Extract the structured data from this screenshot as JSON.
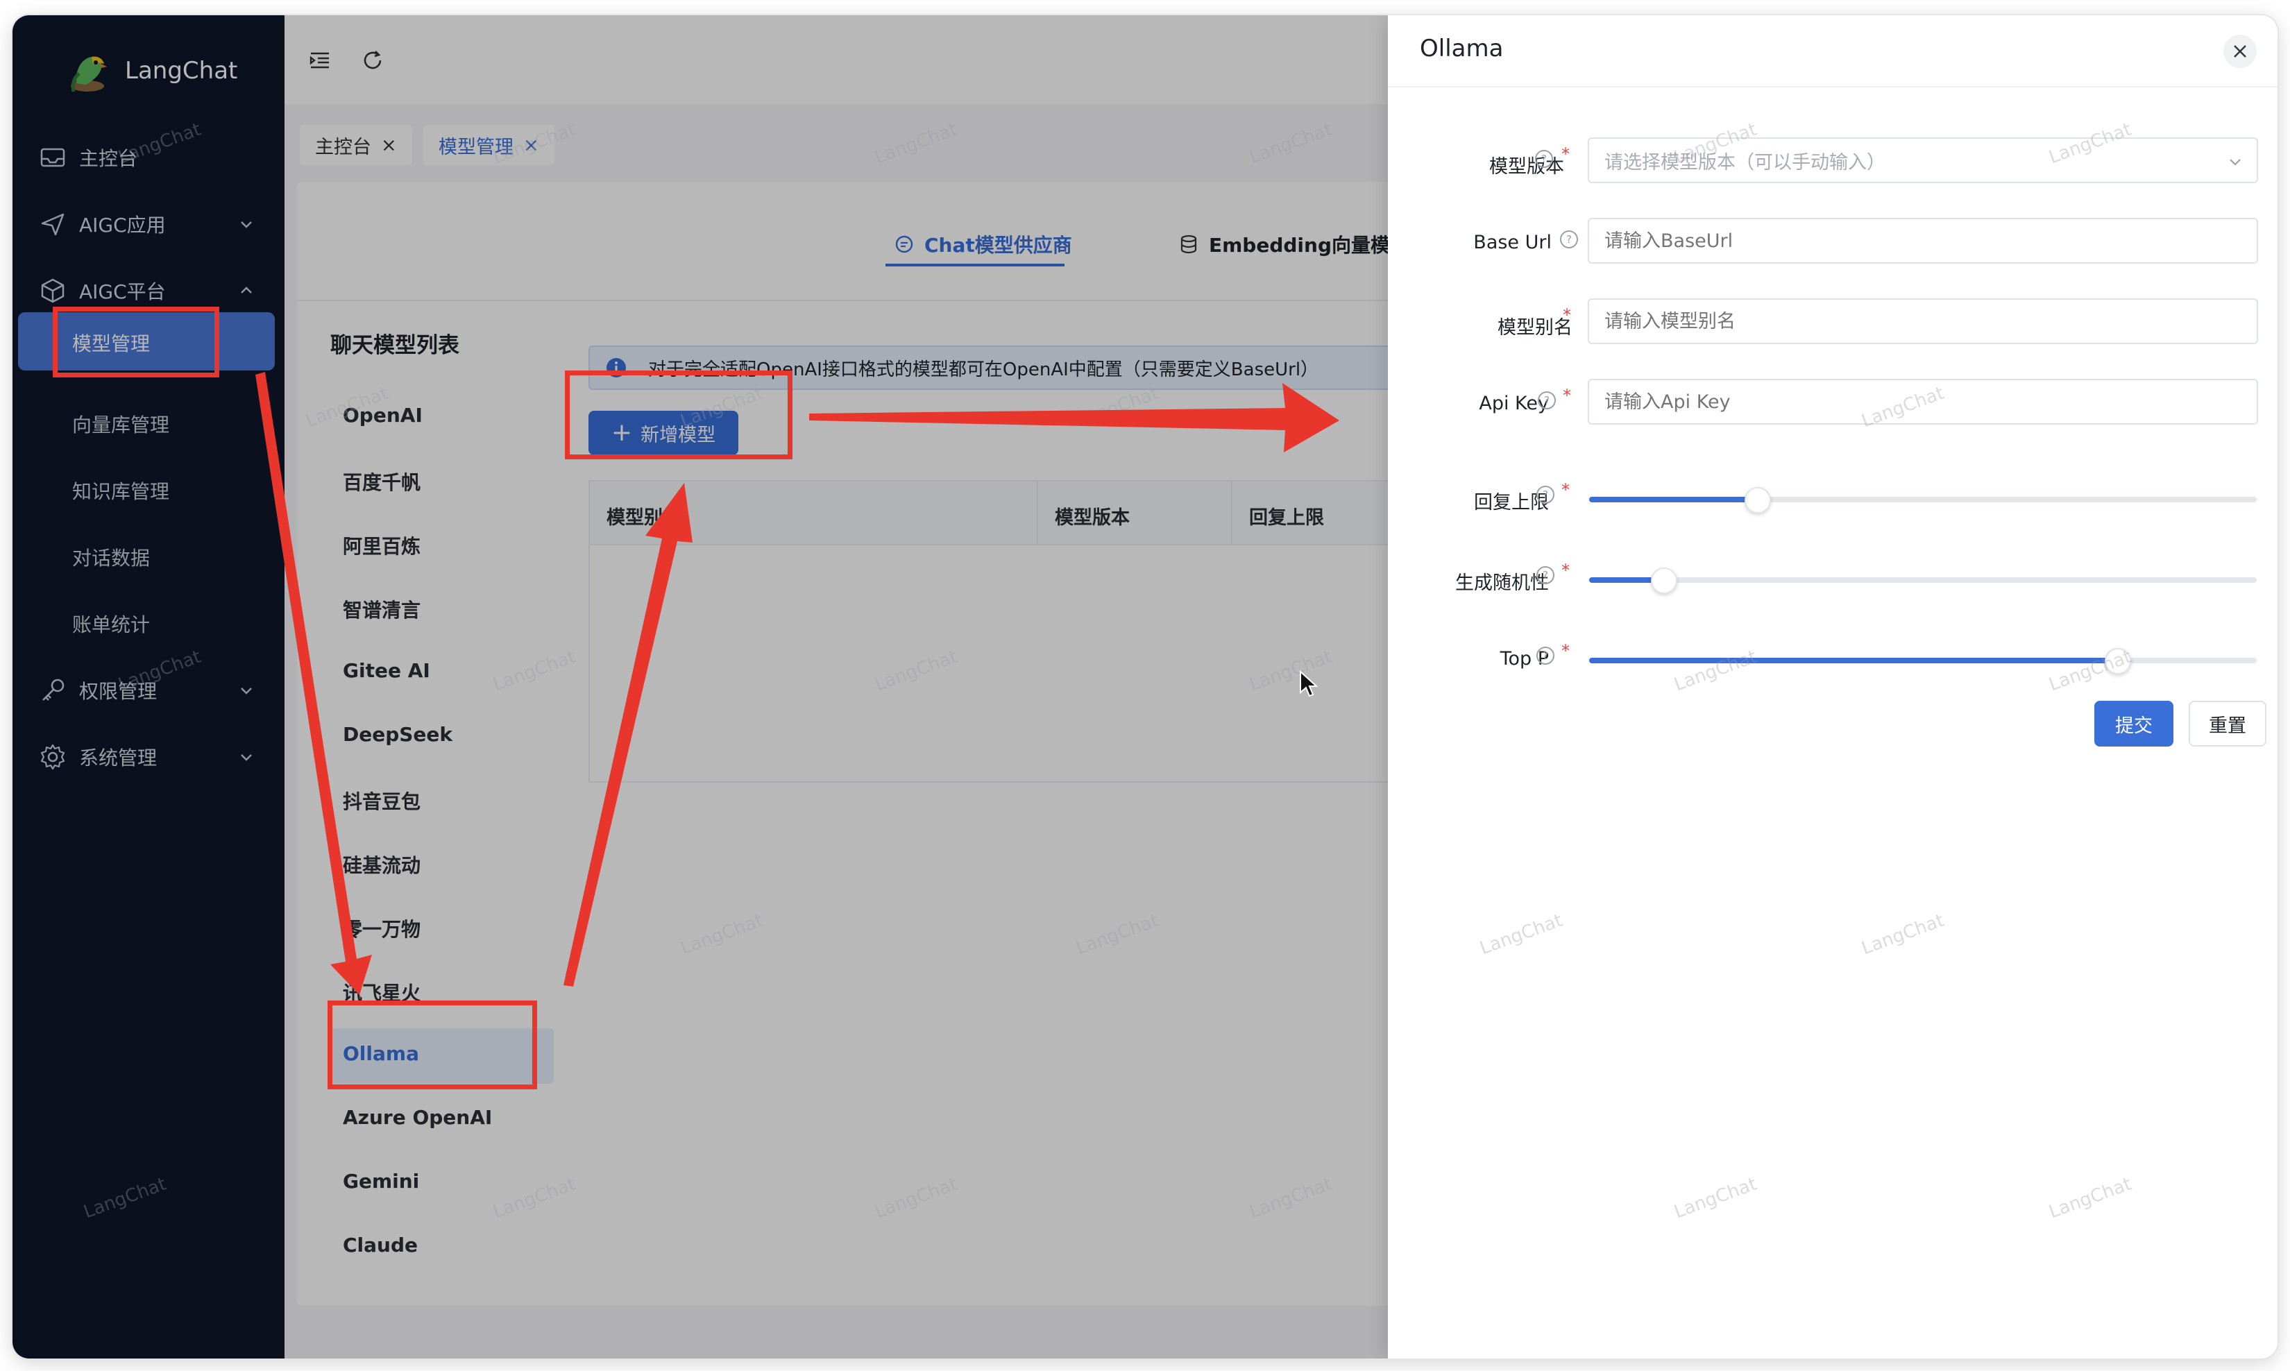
{
  "app": {
    "name": "LangChat"
  },
  "sidebar": {
    "items": [
      {
        "label": "主控台",
        "icon": "inbox-icon"
      },
      {
        "label": "AIGC应用",
        "icon": "send-icon",
        "expandable": true
      },
      {
        "label": "AIGC平台",
        "icon": "cube-icon",
        "expanded": true
      },
      {
        "label": "权限管理",
        "icon": "key-icon",
        "expandable": true
      },
      {
        "label": "系统管理",
        "icon": "gear-icon",
        "expandable": true
      }
    ],
    "sub_items": [
      {
        "label": "模型管理",
        "active": true
      },
      {
        "label": "向量库管理"
      },
      {
        "label": "知识库管理"
      },
      {
        "label": "对话数据"
      },
      {
        "label": "账单统计"
      }
    ]
  },
  "page_tabs": [
    {
      "label": "主控台",
      "close": "×"
    },
    {
      "label": "模型管理",
      "close": "×",
      "active": true
    }
  ],
  "provider_tabs": [
    {
      "label": "Chat模型供应商",
      "active": true
    },
    {
      "label": "Embedding向量模型"
    }
  ],
  "providers": {
    "title": "聊天模型列表",
    "items": [
      "OpenAI",
      "百度千帆",
      "阿里百炼",
      "智谱清言",
      "Gitee AI",
      "DeepSeek",
      "抖音豆包",
      "硅基流动",
      "零一万物",
      "讯飞星火",
      "Ollama",
      "Azure OpenAI",
      "Gemini",
      "Claude"
    ],
    "active": "Ollama"
  },
  "info_bar": {
    "text": "对于完全适配OpenAI接口格式的模型都可在OpenAI中配置（只需要定义BaseUrl）"
  },
  "add_button": {
    "label": "新增模型"
  },
  "table": {
    "columns": [
      "模型别名",
      "模型版本",
      "回复上限"
    ]
  },
  "drawer": {
    "title": "Ollama",
    "fields": [
      {
        "label": "模型版本",
        "placeholder": "请选择模型版本（可以手动输入）",
        "required": true
      },
      {
        "label": "Base Url",
        "placeholder": "请输入BaseUrl",
        "required": false
      },
      {
        "label": "模型别名",
        "placeholder": "请输入模型别名",
        "required": true
      },
      {
        "label": "Api Key",
        "placeholder": "请输入Api Key",
        "required": true
      }
    ],
    "sliders": [
      {
        "label": "回复上限",
        "value": 0.25
      },
      {
        "label": "生成随机性",
        "value": 0.11
      },
      {
        "label": "Top P",
        "value": 0.79
      }
    ],
    "submit_label": "提交",
    "reset_label": "重置"
  },
  "watermark": "LangChat",
  "colors": {
    "accent": "#3a6fd8",
    "sidebar_bg": "#0f1729",
    "annotation": "#e8362c"
  }
}
